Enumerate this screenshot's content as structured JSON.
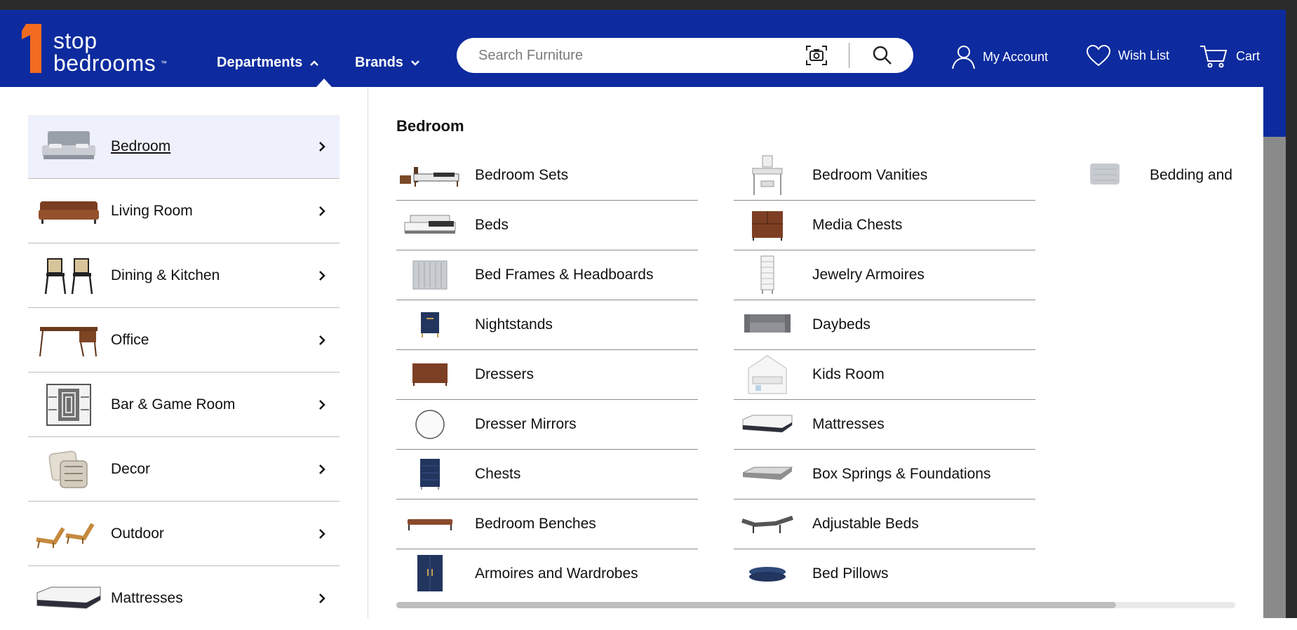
{
  "brand": {
    "logo_line1": "stop",
    "logo_line2": "bedrooms",
    "trademark": "™",
    "number": "1"
  },
  "nav": {
    "departments": "Departments",
    "brands": "Brands"
  },
  "search": {
    "placeholder": "Search Furniture"
  },
  "account": {
    "my_account": "My Account",
    "wish_list": "Wish List",
    "cart": "Cart"
  },
  "departments": [
    {
      "label": "Bedroom"
    },
    {
      "label": "Living Room"
    },
    {
      "label": "Dining & Kitchen"
    },
    {
      "label": "Office"
    },
    {
      "label": "Bar & Game Room"
    },
    {
      "label": "Decor"
    },
    {
      "label": "Outdoor"
    },
    {
      "label": "Mattresses"
    }
  ],
  "active_department": {
    "heading": "Bedroom"
  },
  "col1": [
    {
      "label": "Bedroom Sets"
    },
    {
      "label": "Beds"
    },
    {
      "label": "Bed Frames & Headboards"
    },
    {
      "label": "Nightstands"
    },
    {
      "label": "Dressers"
    },
    {
      "label": "Dresser Mirrors"
    },
    {
      "label": "Chests"
    },
    {
      "label": "Bedroom Benches"
    },
    {
      "label": "Armoires and Wardrobes"
    }
  ],
  "col2": [
    {
      "label": "Bedroom Vanities"
    },
    {
      "label": "Media Chests"
    },
    {
      "label": "Jewelry Armoires"
    },
    {
      "label": "Daybeds"
    },
    {
      "label": "Kids Room"
    },
    {
      "label": "Mattresses"
    },
    {
      "label": "Box Springs & Foundations"
    },
    {
      "label": "Adjustable Beds"
    },
    {
      "label": "Bed Pillows"
    }
  ],
  "col3": [
    {
      "label": "Bedding and"
    }
  ],
  "colors": {
    "navbar": "#0d2b9e",
    "logo_orange": "#f26b21",
    "active_row": "#eef0fb"
  }
}
